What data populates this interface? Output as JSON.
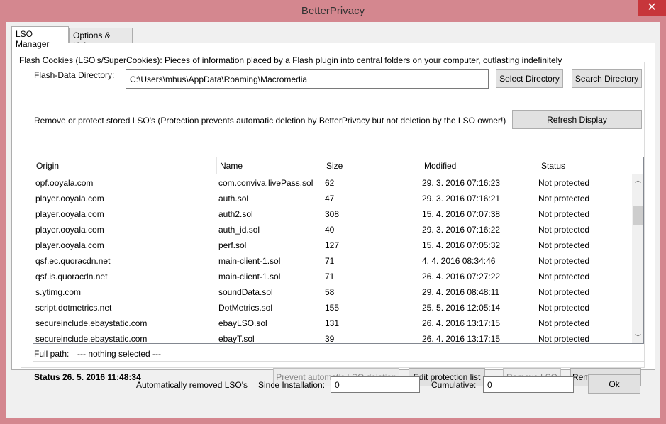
{
  "window": {
    "title": "BetterPrivacy",
    "close_glyph": "✕"
  },
  "tabs": [
    {
      "label": "LSO Manager"
    },
    {
      "label": "Options & Help"
    }
  ],
  "flash": {
    "heading": "Flash Cookies (LSO's/SuperCookies): Pieces of information placed by a Flash plugin into central folders on your computer, outlasting indefinitely",
    "dir_label": "Flash-Data Directory:",
    "dir_value": "C:\\Users\\mhus\\AppData\\Roaming\\Macromedia",
    "select_button": "Select Directory",
    "search_button": "Search Directory"
  },
  "protect": {
    "text": "Remove or protect stored LSO's (Protection prevents automatic deletion by BetterPrivacy but not deletion by the LSO owner!)",
    "refresh_button": "Refresh Display"
  },
  "table": {
    "columns": [
      "Origin",
      "Name",
      "Size",
      "Modified",
      "Status"
    ],
    "rows": [
      [
        "opf.ooyala.com",
        "com.conviva.livePass.sol",
        "62",
        "29. 3. 2016 07:16:23",
        "Not protected"
      ],
      [
        "player.ooyala.com",
        "auth.sol",
        "47",
        "29. 3. 2016 07:16:21",
        "Not protected"
      ],
      [
        "player.ooyala.com",
        "auth2.sol",
        "308",
        "15. 4. 2016 07:07:38",
        "Not protected"
      ],
      [
        "player.ooyala.com",
        "auth_id.sol",
        "40",
        "29. 3. 2016 07:16:22",
        "Not protected"
      ],
      [
        "player.ooyala.com",
        "perf.sol",
        "127",
        "15. 4. 2016 07:05:32",
        "Not protected"
      ],
      [
        "qsf.ec.quoracdn.net",
        "main-client-1.sol",
        "71",
        "4. 4. 2016 08:34:46",
        "Not protected"
      ],
      [
        "qsf.is.quoracdn.net",
        "main-client-1.sol",
        "71",
        "26. 4. 2016 07:27:22",
        "Not protected"
      ],
      [
        "s.ytimg.com",
        "soundData.sol",
        "58",
        "29. 4. 2016 08:48:11",
        "Not protected"
      ],
      [
        "script.dotmetrics.net",
        "DotMetrics.sol",
        "155",
        "25. 5. 2016 12:05:14",
        "Not protected"
      ],
      [
        "secureinclude.ebaystatic.com",
        "ebayLSO.sol",
        "131",
        "26. 4. 2016 13:17:15",
        "Not protected"
      ],
      [
        "secureinclude.ebaystatic.com",
        "ebayT.sol",
        "39",
        "26. 4. 2016 13:17:15",
        "Not protected"
      ]
    ],
    "scroll_up_glyph": "︿",
    "scroll_down_glyph": "﹀"
  },
  "fullpath": {
    "label": "Full path:",
    "value": "--- nothing selected ---"
  },
  "status": {
    "text": "Status 26. 5. 2016 11:48:34"
  },
  "actions": {
    "prevent": "Prevent automatic LSO deletion",
    "edit": "Edit protection list",
    "remove": "Remove LSO",
    "remove_all": "Remove All LSOs"
  },
  "footer": {
    "auto_removed_label": "Automatically removed LSO's",
    "since_label": "Since Installation:",
    "since_value": "0",
    "cumulative_label": "Cumulative:",
    "cumulative_value": "0",
    "ok_button": "Ok"
  }
}
